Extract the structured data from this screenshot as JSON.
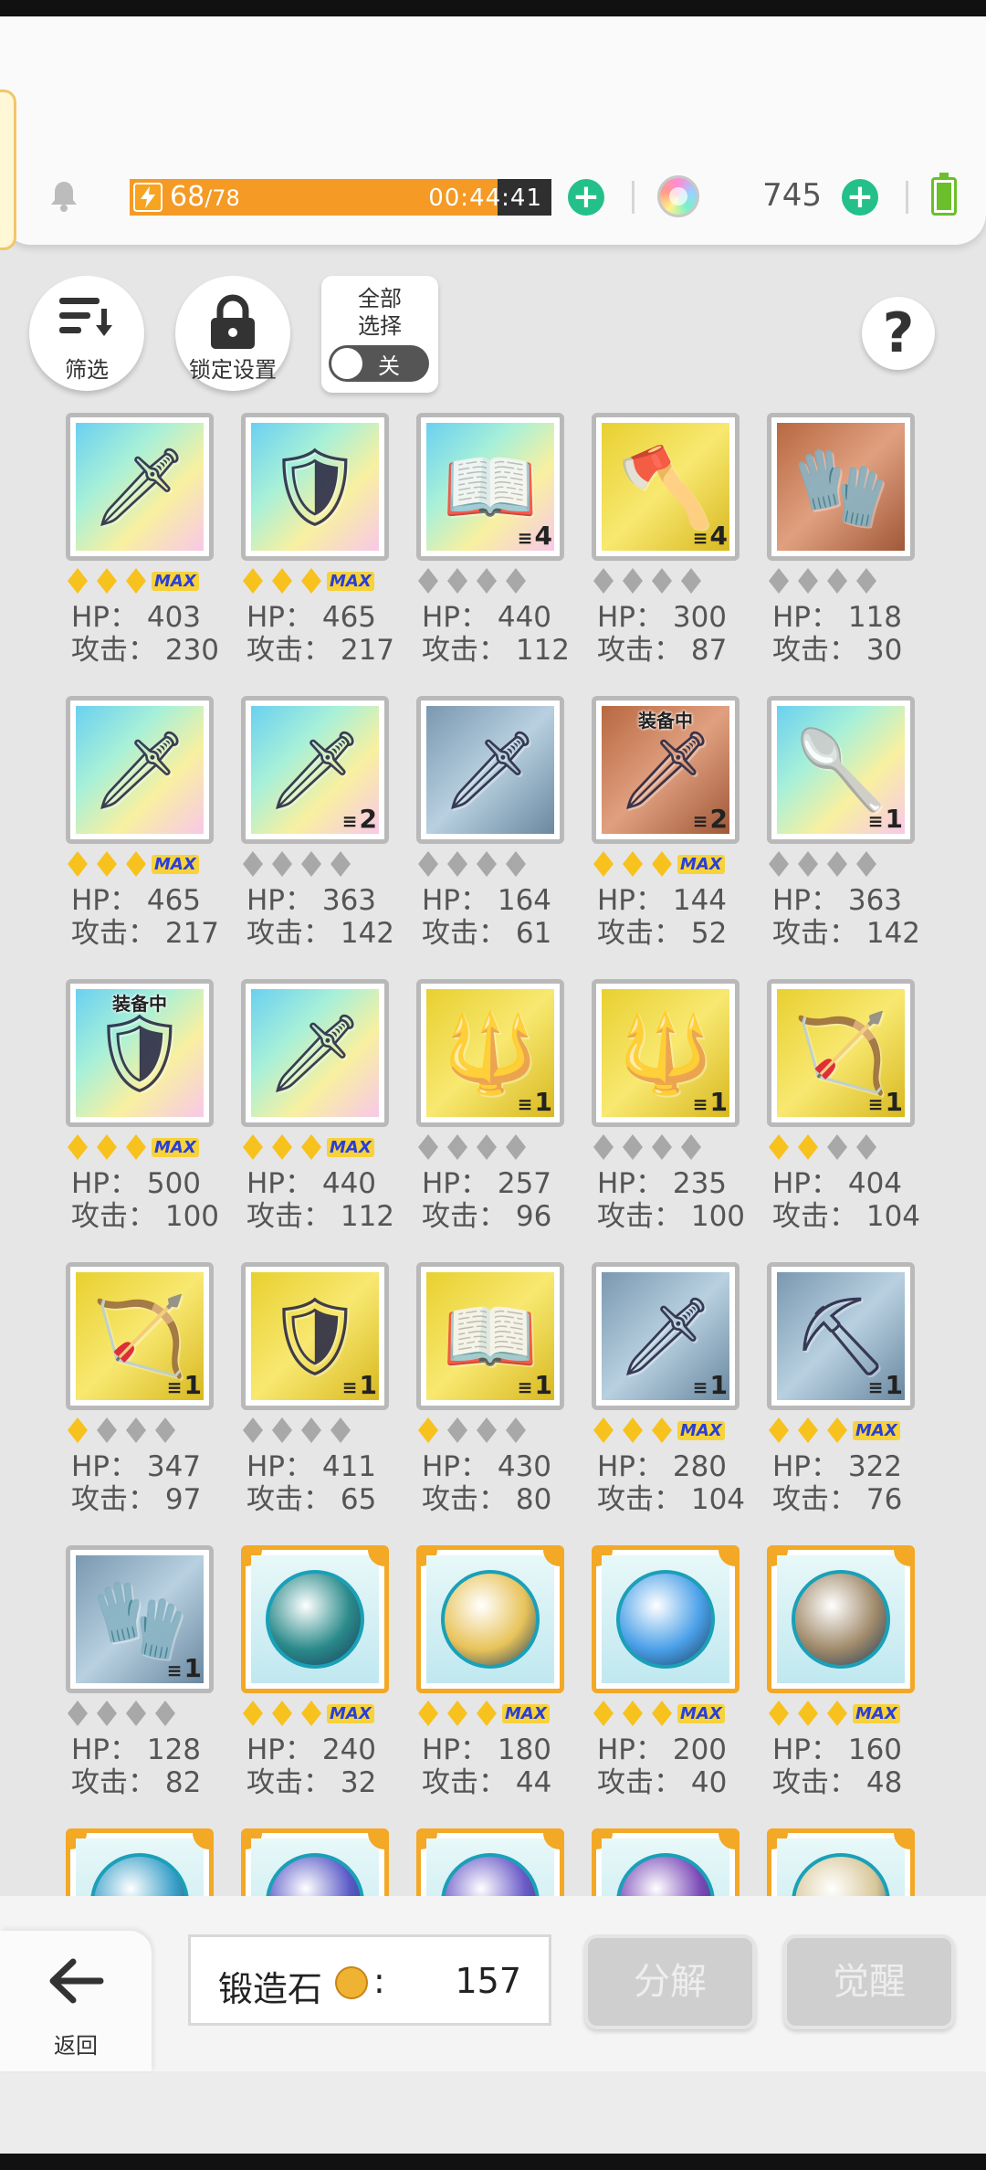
{
  "header": {
    "energy_current": "68",
    "energy_max": "/78",
    "energy_fraction": 0.872,
    "energy_timer": "00:44:41",
    "gem_count": "745"
  },
  "toolbar": {
    "filter_label": "筛选",
    "lock_label": "锁定设置",
    "select_all_label_line1": "全部",
    "select_all_label_line2": "选择",
    "toggle_state": "关",
    "help_label": "?"
  },
  "labels": {
    "hp": "HP：",
    "atk": "攻击：",
    "max": "MAX",
    "equipped": "装备中"
  },
  "items": [
    {
      "glyph": "🗡",
      "bg": "rainbow",
      "stars": 2,
      "max": true,
      "hp": "403",
      "atk": "230",
      "count": "",
      "equipped": false
    },
    {
      "glyph": "🛡",
      "bg": "rainbow",
      "stars": 2,
      "max": true,
      "hp": "465",
      "atk": "217",
      "count": "",
      "equipped": false
    },
    {
      "glyph": "📖",
      "bg": "rainbow",
      "stars": 0,
      "max": false,
      "hp": "440",
      "atk": "112",
      "count": "4",
      "equipped": false
    },
    {
      "glyph": "🪓",
      "bg": "gold",
      "stars": 0,
      "max": false,
      "hp": "300",
      "atk": "87",
      "count": "4",
      "equipped": false
    },
    {
      "glyph": "🧤",
      "bg": "bronze",
      "stars": 0,
      "max": false,
      "hp": "118",
      "atk": "30",
      "count": "",
      "equipped": false
    },
    {
      "glyph": "🗡",
      "bg": "rainbow",
      "stars": 2,
      "max": true,
      "hp": "465",
      "atk": "217",
      "count": "",
      "equipped": false
    },
    {
      "glyph": "🗡",
      "bg": "rainbow",
      "stars": 0,
      "max": false,
      "hp": "363",
      "atk": "142",
      "count": "2",
      "equipped": false
    },
    {
      "glyph": "🗡",
      "bg": "silver",
      "stars": 0,
      "max": false,
      "hp": "164",
      "atk": "61",
      "count": "",
      "equipped": false
    },
    {
      "glyph": "🗡",
      "bg": "bronze",
      "stars": 2,
      "max": true,
      "hp": "144",
      "atk": "52",
      "count": "2",
      "equipped": true
    },
    {
      "glyph": "🥄",
      "bg": "rainbow",
      "stars": 0,
      "max": false,
      "hp": "363",
      "atk": "142",
      "count": "1",
      "equipped": false
    },
    {
      "glyph": "🛡",
      "bg": "rainbow",
      "stars": 2,
      "max": true,
      "hp": "500",
      "atk": "100",
      "count": "",
      "equipped": true
    },
    {
      "glyph": "🗡",
      "bg": "rainbow",
      "stars": 2,
      "max": true,
      "hp": "440",
      "atk": "112",
      "count": "",
      "equipped": false
    },
    {
      "glyph": "🔱",
      "bg": "gold",
      "stars": 0,
      "max": false,
      "hp": "257",
      "atk": "96",
      "count": "1",
      "equipped": false
    },
    {
      "glyph": "🔱",
      "bg": "gold",
      "stars": 0,
      "max": false,
      "hp": "235",
      "atk": "100",
      "count": "1",
      "equipped": false
    },
    {
      "glyph": "🏹",
      "bg": "gold",
      "stars": 2,
      "max": false,
      "hp": "404",
      "atk": "104",
      "count": "1",
      "equipped": false
    },
    {
      "glyph": "🏹",
      "bg": "gold",
      "stars": 1,
      "max": false,
      "hp": "347",
      "atk": "97",
      "count": "1",
      "equipped": false
    },
    {
      "glyph": "🛡",
      "bg": "gold",
      "stars": 0,
      "max": false,
      "hp": "411",
      "atk": "65",
      "count": "1",
      "equipped": false
    },
    {
      "glyph": "📖",
      "bg": "gold",
      "stars": 1,
      "max": false,
      "hp": "430",
      "atk": "80",
      "count": "1",
      "equipped": false
    },
    {
      "glyph": "🗡",
      "bg": "silver",
      "stars": 2,
      "max": true,
      "hp": "280",
      "atk": "104",
      "count": "1",
      "equipped": false
    },
    {
      "glyph": "⛏",
      "bg": "silver",
      "stars": 2,
      "max": true,
      "hp": "322",
      "atk": "76",
      "count": "1",
      "equipped": false
    },
    {
      "glyph": "🧤",
      "bg": "silver",
      "stars": 0,
      "max": false,
      "hp": "128",
      "atk": "82",
      "count": "1",
      "equipped": false
    },
    {
      "glyph": "",
      "bg": "orb",
      "orb": "#2a8a8a",
      "stars": 2,
      "max": true,
      "hp": "240",
      "atk": "32",
      "count": "",
      "equipped": false
    },
    {
      "glyph": "",
      "bg": "orb",
      "orb": "#e8c35a",
      "stars": 2,
      "max": true,
      "hp": "180",
      "atk": "44",
      "count": "",
      "equipped": false
    },
    {
      "glyph": "",
      "bg": "orb",
      "orb": "#4aa0e8",
      "stars": 2,
      "max": true,
      "hp": "200",
      "atk": "40",
      "count": "",
      "equipped": false
    },
    {
      "glyph": "",
      "bg": "orb",
      "orb": "#a08a6a",
      "stars": 2,
      "max": true,
      "hp": "160",
      "atk": "48",
      "count": "",
      "equipped": false
    },
    {
      "glyph": "",
      "bg": "orb",
      "orb": "#3aa0c8",
      "stars": 0,
      "max": false,
      "hp": "",
      "atk": "",
      "count": "",
      "equipped": false
    },
    {
      "glyph": "",
      "bg": "orb",
      "orb": "#5a5ac8",
      "stars": 0,
      "max": false,
      "hp": "",
      "atk": "",
      "count": "",
      "equipped": false
    },
    {
      "glyph": "",
      "bg": "orb",
      "orb": "#6a5ac8",
      "stars": 0,
      "max": false,
      "hp": "",
      "atk": "",
      "count": "",
      "equipped": false
    },
    {
      "glyph": "",
      "bg": "orb",
      "orb": "#7a4ab8",
      "stars": 0,
      "max": false,
      "hp": "",
      "atk": "",
      "count": "",
      "equipped": false
    },
    {
      "glyph": "",
      "bg": "orb",
      "orb": "#d8c89a",
      "stars": 0,
      "max": false,
      "hp": "",
      "atk": "",
      "count": "",
      "equipped": false
    }
  ],
  "bottom": {
    "back_label": "返回",
    "forge_label": "锻造石",
    "forge_colon": ":",
    "forge_value": "157",
    "decompose_label": "分解",
    "awaken_label": "觉醒"
  }
}
